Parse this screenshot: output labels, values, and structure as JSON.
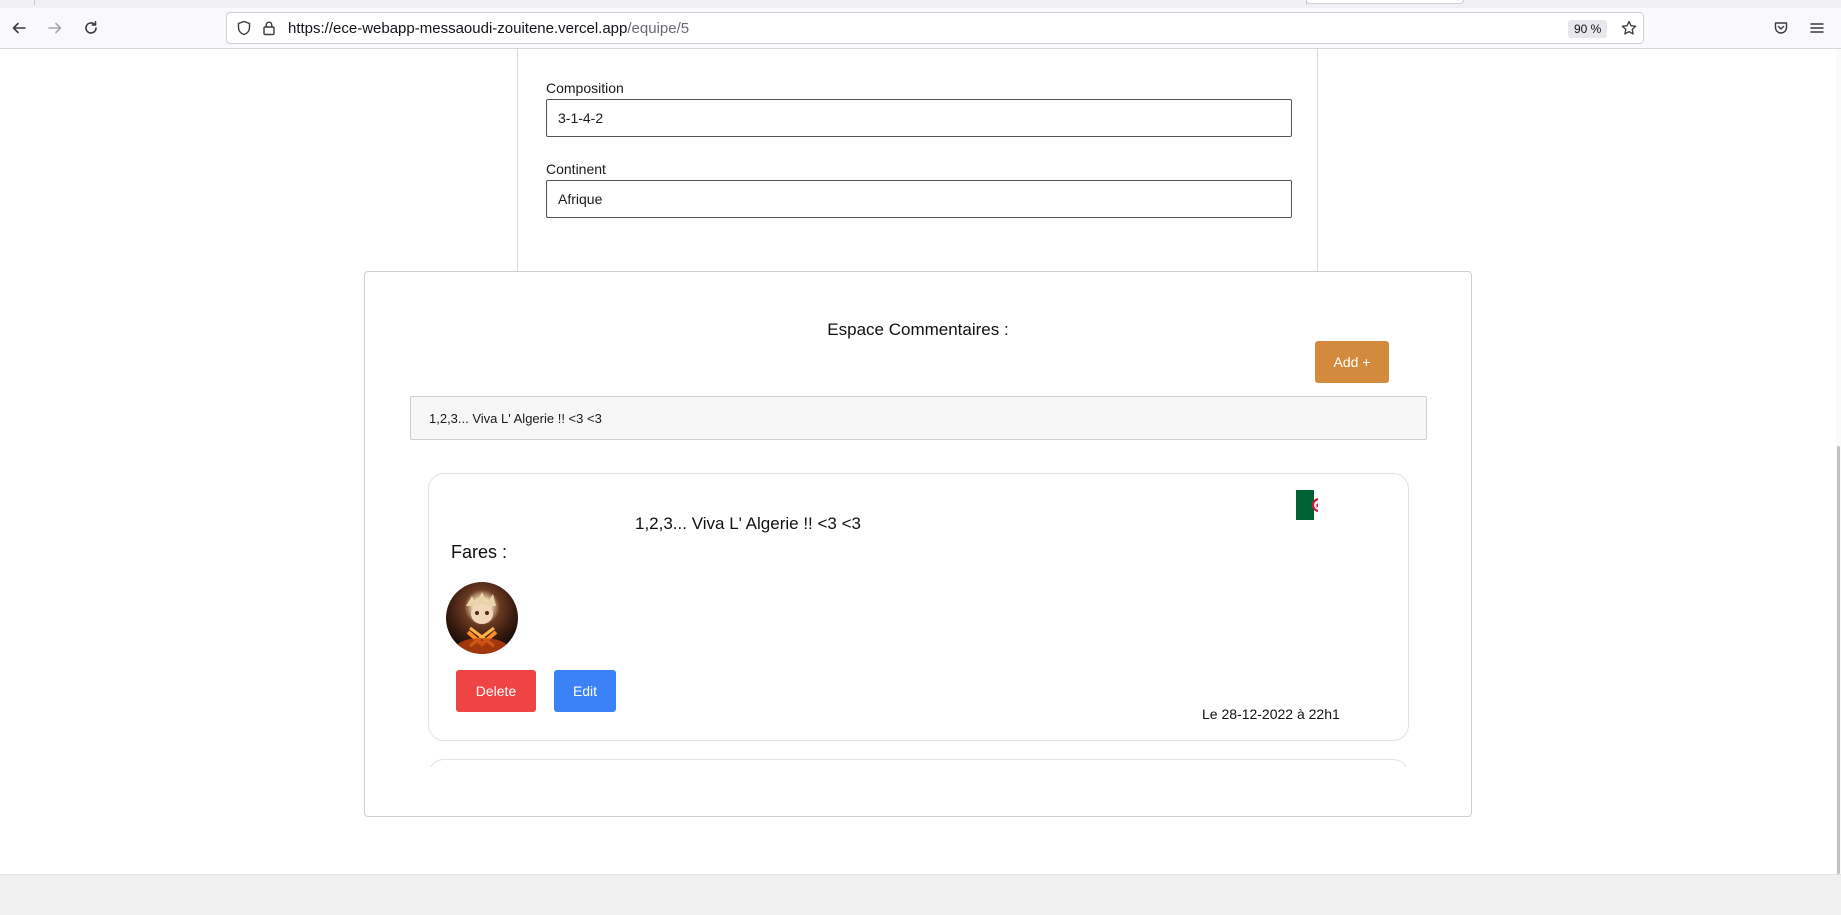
{
  "browser": {
    "url_host": "https://ece-webapp-messaoudi-zouitene.vercel.app",
    "url_path": "/equipe/5",
    "zoom": "90 %",
    "icons": [
      "back-arrow-icon",
      "forward-arrow-icon",
      "reload-icon",
      "shield-icon",
      "lock-icon",
      "bookmark-star-icon",
      "pocket-icon",
      "hamburger-menu-icon"
    ]
  },
  "form": {
    "composition_label": "Composition",
    "composition_value": "3-1-4-2",
    "continent_label": "Continent",
    "continent_value": "Afrique"
  },
  "comments": {
    "title": "Espace Commentaires :",
    "add_label": "Add +",
    "new_comment_value": "1,2,3... Viva L' Algerie !! <3 <3",
    "items": [
      {
        "text": "1,2,3... Viva L' Algerie !! <3 <3",
        "author": "Fares :",
        "flag": "algeria-flag",
        "delete_label": "Delete",
        "edit_label": "Edit",
        "date": "Le 28-12-2022 à 22h1"
      }
    ]
  },
  "colors": {
    "add_button": "#d48a3c",
    "delete_button": "#ef4444",
    "edit_button": "#3b82f6",
    "flag_green": "#006233",
    "flag_red": "#d21034"
  }
}
